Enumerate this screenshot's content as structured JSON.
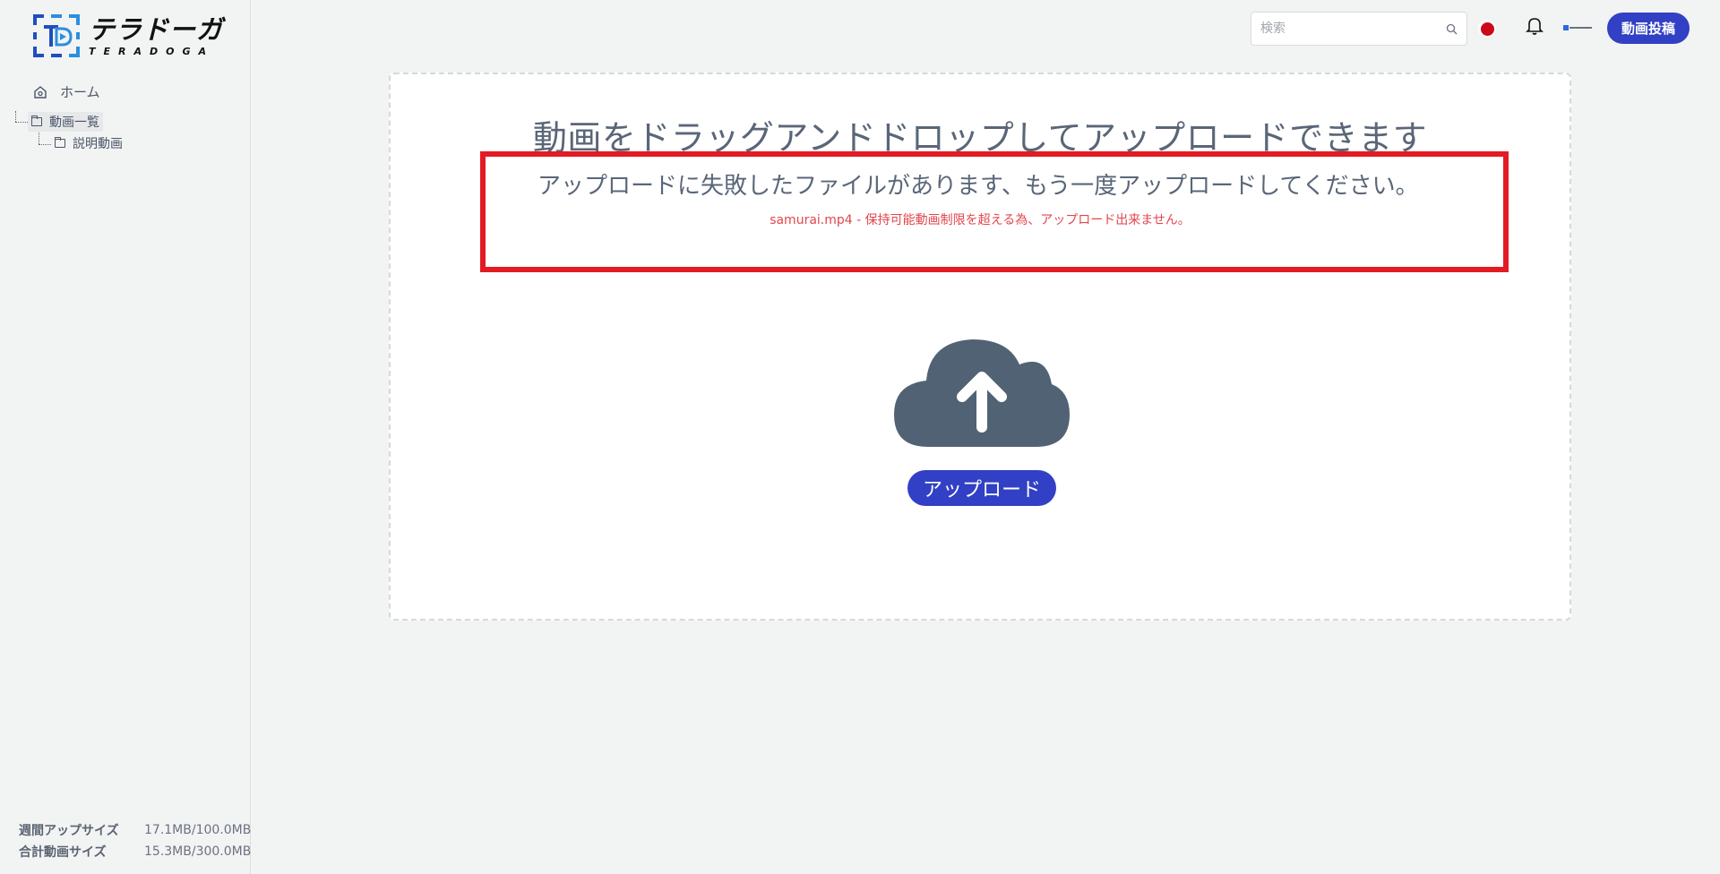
{
  "brand": {
    "logo_ja": "テラドーガ",
    "logo_en": "TERADOGA"
  },
  "sidebar": {
    "home_label": "ホーム",
    "tree": {
      "root_label": "動画一覧",
      "children": [
        "説明動画"
      ]
    },
    "usage": [
      {
        "label": "週間アップサイズ",
        "value": "17.1MB/100.0MB"
      },
      {
        "label": "合計動画サイズ",
        "value": "15.3MB/300.0MB"
      }
    ]
  },
  "header": {
    "search_placeholder": "検索",
    "post_button": "動画投稿"
  },
  "dropzone": {
    "title": "動画をドラッグアンドドロップしてアップロードできます",
    "error_title": "アップロードに失敗したファイルがあります、もう一度アップロードしてください。",
    "error_detail": "samurai.mp4 - 保持可能動画制限を超える為、アップロード出来ません。",
    "upload_button": "アップロード"
  },
  "colors": {
    "accent": "#3140c4",
    "error": "#e2464d",
    "highlight": "#e31b23",
    "cloud": "#526275"
  }
}
